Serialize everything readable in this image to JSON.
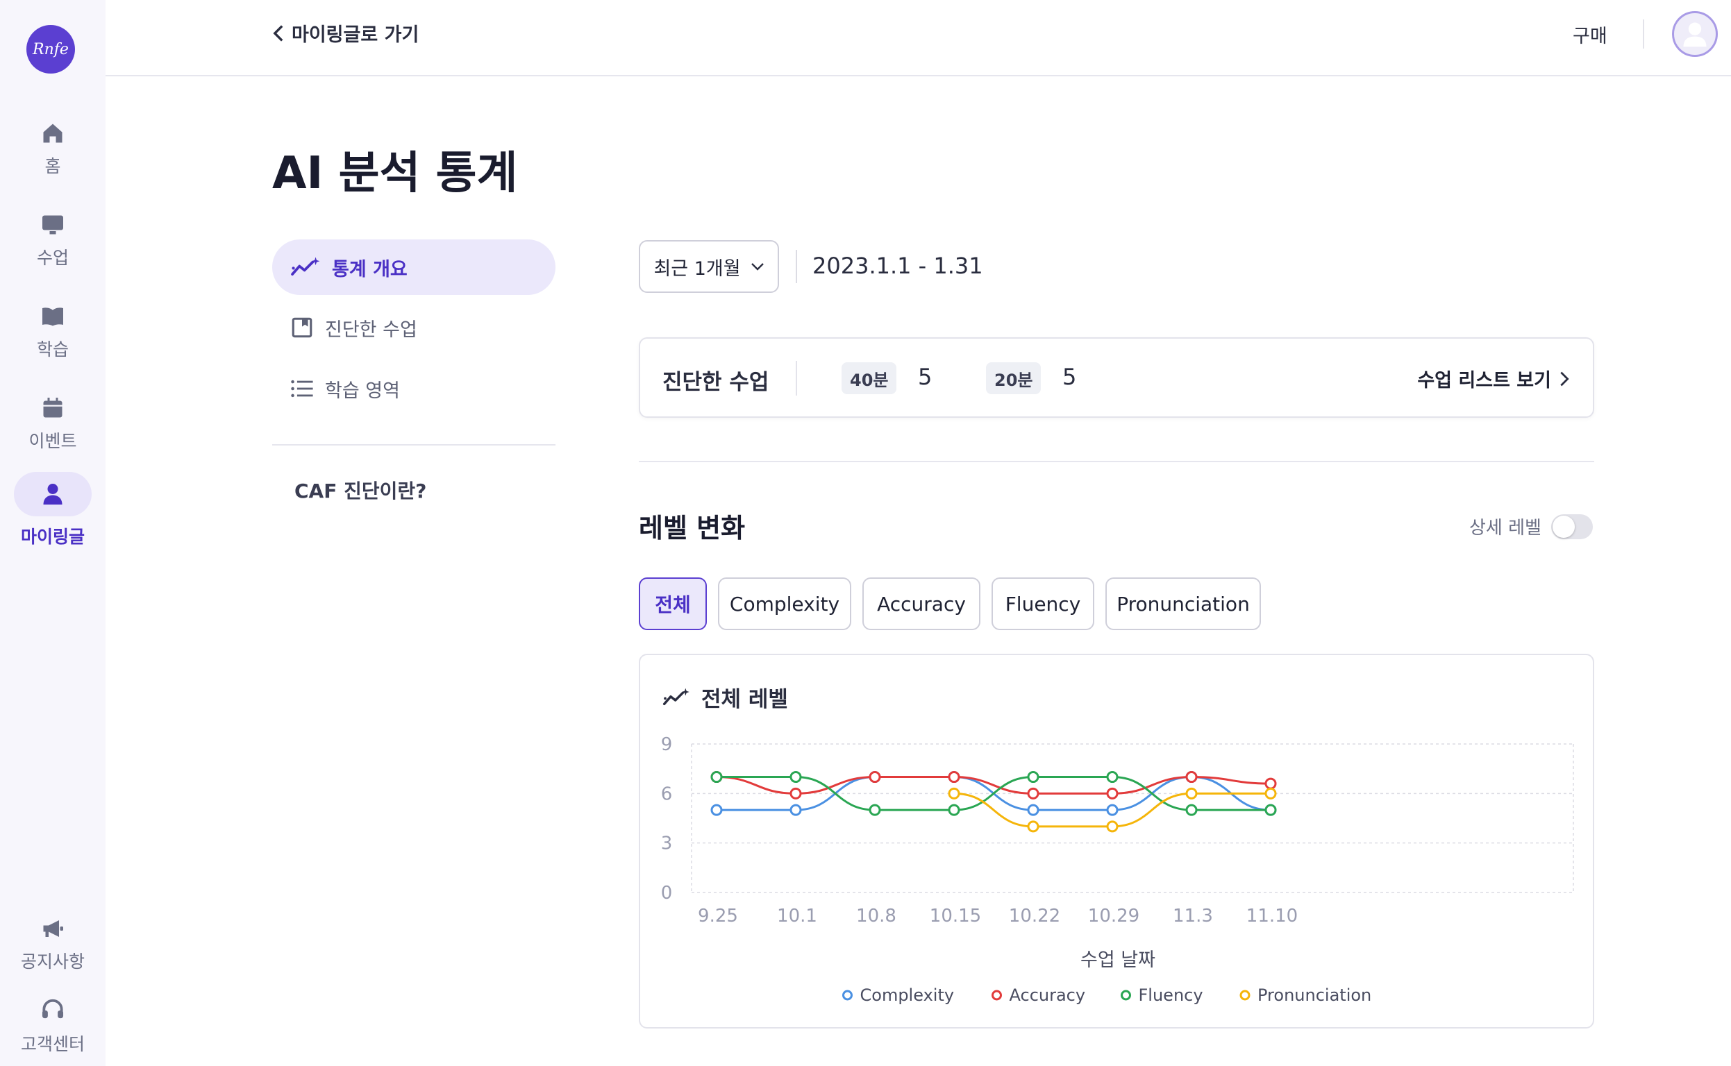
{
  "brand": {
    "logo_text": "Rnfe",
    "accent": "#5b3fd1"
  },
  "rail": {
    "items": [
      {
        "label": "홈",
        "icon": "home-icon"
      },
      {
        "label": "수업",
        "icon": "monitor-icon"
      },
      {
        "label": "학습",
        "icon": "book-icon"
      },
      {
        "label": "이벤트",
        "icon": "calendar-icon"
      },
      {
        "label": "마이링글",
        "icon": "user-icon",
        "active": true
      }
    ],
    "bottom": [
      {
        "label": "공지사항",
        "icon": "megaphone-icon"
      },
      {
        "label": "고객센터",
        "icon": "headset-icon"
      }
    ]
  },
  "topbar": {
    "back_label": "마이링글로 가기",
    "buy_label": "구매"
  },
  "page": {
    "title": "AI 분석 통계"
  },
  "subnav": {
    "items": [
      {
        "label": "통계 개요",
        "icon": "sparkle-chart-icon",
        "active": true
      },
      {
        "label": "진단한 수업",
        "icon": "bookmark-icon"
      },
      {
        "label": "학습 영역",
        "icon": "list-icon"
      }
    ],
    "caf_link": "CAF 진단이란?"
  },
  "period": {
    "selected": "최근 1개월",
    "range": "2023.1.1 - 1.31"
  },
  "lessons": {
    "title": "진단한 수업",
    "durations": [
      {
        "badge": "40분",
        "count": "5"
      },
      {
        "badge": "20분",
        "count": "5"
      }
    ],
    "link_label": "수업 리스트 보기"
  },
  "level": {
    "title": "레벨 변화",
    "detail_label": "상세 레벨",
    "detail_on": false,
    "tabs": [
      {
        "label": "전체",
        "active": true
      },
      {
        "label": "Complexity"
      },
      {
        "label": "Accuracy"
      },
      {
        "label": "Fluency"
      },
      {
        "label": "Pronunciation"
      }
    ]
  },
  "chart_card": {
    "title": "전체 레벨"
  },
  "chart_data": {
    "type": "line",
    "title": "전체 레벨",
    "xlabel": "수업 날짜",
    "ylabel": "",
    "categories": [
      "9.25",
      "10.1",
      "10.8",
      "10.15",
      "10.22",
      "10.29",
      "11.3",
      "11.10"
    ],
    "yticks": [
      0,
      3,
      6,
      9
    ],
    "ylim": [
      0,
      9
    ],
    "grid": true,
    "legend_position": "bottom",
    "series": [
      {
        "name": "Complexity",
        "color": "#4a90e2",
        "values": [
          5,
          5,
          7,
          7,
          5,
          5,
          7,
          5
        ]
      },
      {
        "name": "Accuracy",
        "color": "#e23b3b",
        "values": [
          7,
          6,
          7,
          7,
          6,
          6,
          7,
          6.6
        ]
      },
      {
        "name": "Fluency",
        "color": "#2aa653",
        "values": [
          7,
          7,
          5,
          5,
          7,
          7,
          5,
          5
        ]
      },
      {
        "name": "Pronunciation",
        "color": "#f5b50a",
        "values": [
          null,
          null,
          null,
          6,
          4,
          4,
          6,
          6
        ]
      }
    ]
  }
}
